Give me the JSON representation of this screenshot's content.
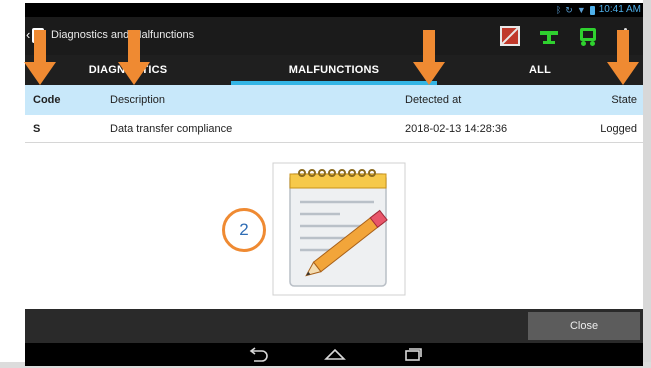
{
  "statusbar": {
    "time": "10:41 AM",
    "icons": [
      "bluetooth-icon",
      "sync-icon",
      "wifi-icon",
      "battery-icon"
    ]
  },
  "actionbar": {
    "title": "Diagnostics and Malfunctions",
    "icons": [
      "no-signal-icon",
      "connection-icon",
      "truck-icon",
      "overflow-menu-icon"
    ]
  },
  "tabs": [
    {
      "label": "DIAGNOSTICS",
      "active": false
    },
    {
      "label": "MALFUNCTIONS",
      "active": true
    },
    {
      "label": "ALL",
      "active": false
    }
  ],
  "table": {
    "headers": {
      "code": "Code",
      "description": "Description",
      "detected_at": "Detected at",
      "state": "State"
    },
    "rows": [
      {
        "code": "S",
        "description": "Data transfer compliance",
        "detected_at": "2018-02-13 14:28:36",
        "state": "Logged"
      }
    ]
  },
  "illustration": "notepad-pencil-icon",
  "footer": {
    "close_label": "Close"
  },
  "navbar": {
    "icons": [
      "back-icon",
      "home-icon",
      "recent-apps-icon"
    ]
  },
  "annotation": {
    "badge_number": "2",
    "arrow_color": "#ef8a32"
  },
  "colors": {
    "tab_indicator": "#33b5e5",
    "header_bg": "#c8e8fa",
    "status_green": "#2fd12f"
  }
}
